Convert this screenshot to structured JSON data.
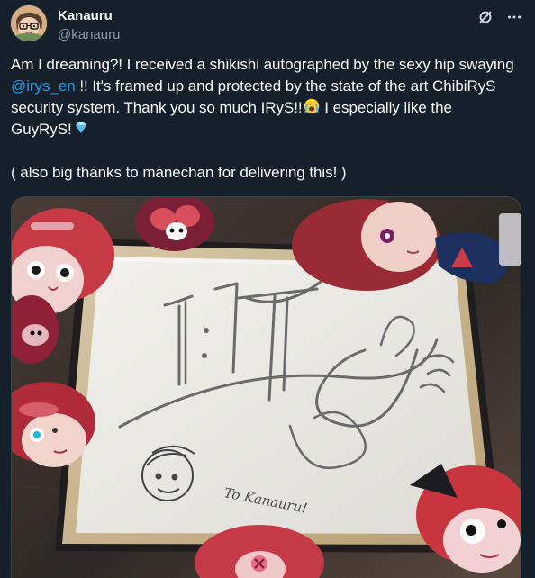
{
  "author": {
    "display_name": "Kanauru",
    "username": "@kanauru"
  },
  "header_actions": {
    "grok_icon": "grok-icon",
    "more_icon": "more-horizontal-icon"
  },
  "tweet": {
    "line1_a": "Am I dreaming?! I received a shikishi autographed by the sexy hip swaying ",
    "mention": "@irys_en",
    "line1_b": " !! It's framed up and protected by the state of the art ChibiRyS security system. Thank you so much IRyS!!",
    "emoji_crying": "loudly-crying-face-emoji",
    "line1_c": " I especially like the GuyRyS!",
    "emoji_gem": "gem-stone-emoji",
    "line2": "( also big thanks to manechan for delivering this! )"
  },
  "media": {
    "signature_note": "To Kanauru!"
  },
  "colors": {
    "background": "#15202b",
    "text": "#f7f9f9",
    "secondary_text": "#8b98a5",
    "accent": "#1d9bf0"
  }
}
